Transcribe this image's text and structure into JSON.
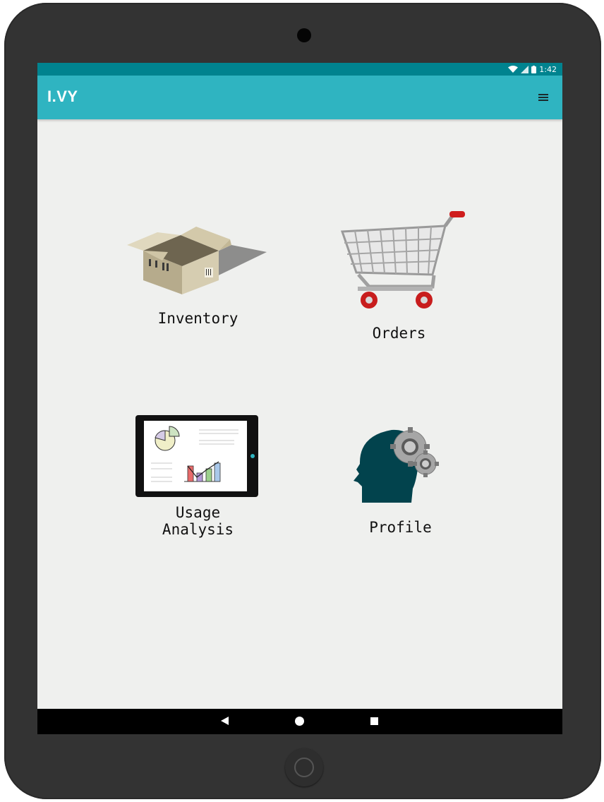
{
  "status": {
    "time": "1:42",
    "wifi_icon": "wifi-icon",
    "signal_icon": "signal-icon",
    "battery_icon": "battery-icon"
  },
  "app": {
    "title": "I.VY",
    "menu_icon": "hamburger-menu-icon"
  },
  "tiles": [
    {
      "label": "Inventory",
      "icon": "cardboard-box-icon"
    },
    {
      "label": "Orders",
      "icon": "shopping-cart-icon"
    },
    {
      "label": "Usage\nAnalysis",
      "icon": "tablet-chart-icon"
    },
    {
      "label": "Profile",
      "icon": "head-gears-icon"
    }
  ],
  "nav": {
    "back_icon": "back-icon",
    "home_icon": "home-icon",
    "recents_icon": "recents-icon"
  },
  "colors": {
    "statusbar": "#00838f",
    "appbar": "#2fb4c1",
    "background": "#eff0ee"
  }
}
